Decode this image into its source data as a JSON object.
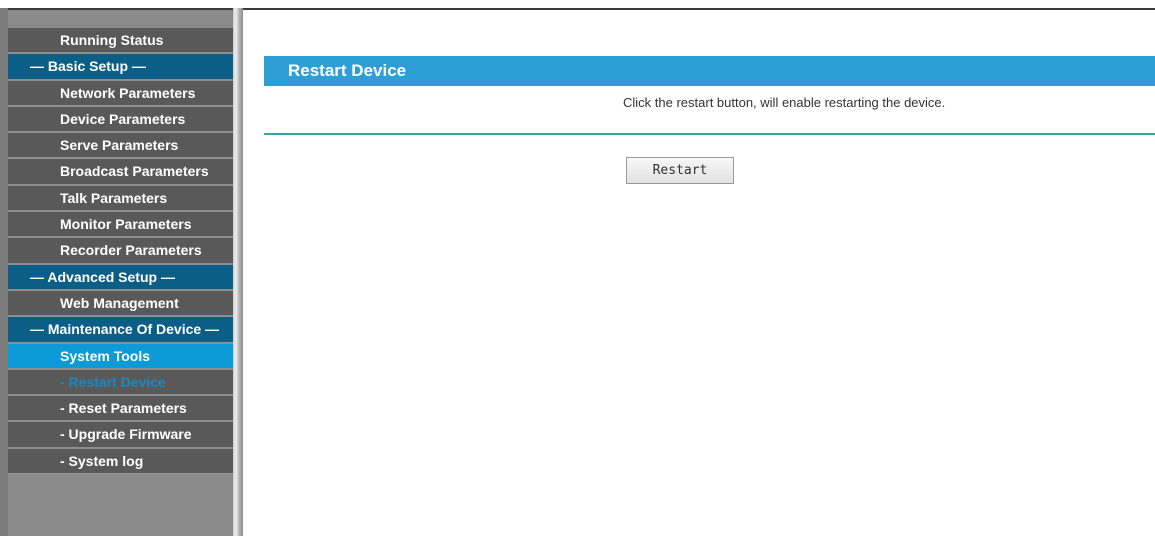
{
  "sidebar": {
    "items": [
      {
        "label": "Running Status"
      },
      {
        "label": "— Basic Setup —"
      },
      {
        "label": "Network Parameters"
      },
      {
        "label": "Device Parameters"
      },
      {
        "label": "Serve Parameters"
      },
      {
        "label": "Broadcast Parameters"
      },
      {
        "label": "Talk Parameters"
      },
      {
        "label": "Monitor Parameters"
      },
      {
        "label": "Recorder Parameters"
      },
      {
        "label": "— Advanced Setup —"
      },
      {
        "label": "Web Management"
      },
      {
        "label": "— Maintenance Of Device —"
      },
      {
        "label": "System Tools"
      },
      {
        "label": "- Restart Device"
      },
      {
        "label": "- Reset Parameters"
      },
      {
        "label": "- Upgrade Firmware"
      },
      {
        "label": "- System log"
      }
    ]
  },
  "main": {
    "title": "Restart Device",
    "description": "Click the restart button, will enable restarting the device.",
    "restart_label": "Restart"
  },
  "colors": {
    "accent": "#2e9fd6",
    "section_header": "#0b5f86",
    "active_menu": "#0c9bd6",
    "divider": "#35a4a6"
  }
}
